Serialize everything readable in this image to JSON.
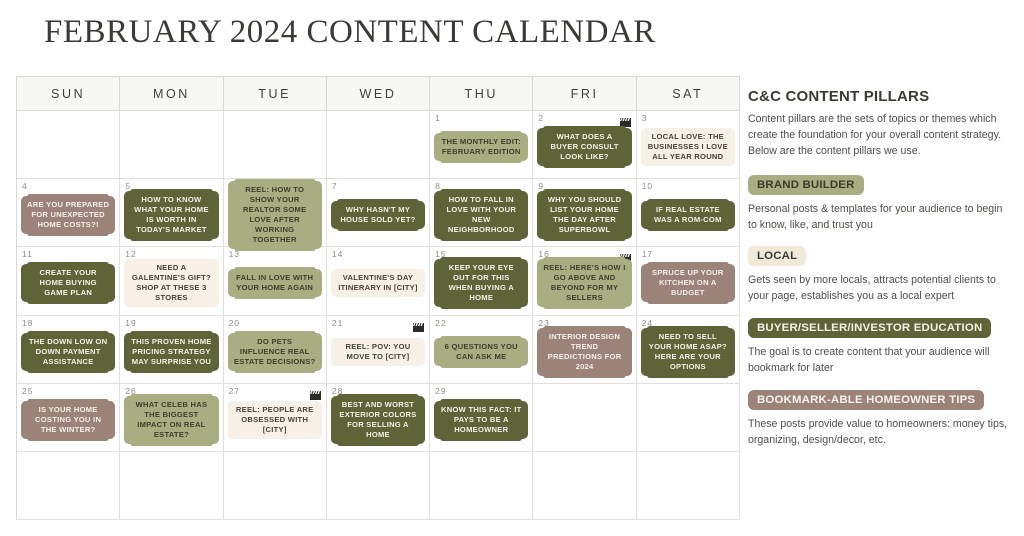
{
  "header": {
    "title": "FEBRUARY 2024 CONTENT CALENDAR"
  },
  "calendar": {
    "day_headers": [
      "SUN",
      "MON",
      "TUE",
      "WED",
      "THU",
      "FRI",
      "SAT"
    ],
    "weeks": [
      [
        {
          "day": "",
          "text": "",
          "style": "none",
          "reel": false
        },
        {
          "day": "",
          "text": "",
          "style": "none",
          "reel": false
        },
        {
          "day": "",
          "text": "",
          "style": "none",
          "reel": false
        },
        {
          "day": "",
          "text": "",
          "style": "none",
          "reel": false
        },
        {
          "day": "1",
          "text": "THE MONTHLY EDIT: FEBRUARY EDITION",
          "style": "light",
          "reel": false
        },
        {
          "day": "2",
          "text": "WHAT DOES A BUYER CONSULT LOOK LIKE?",
          "style": "dark",
          "reel": true
        },
        {
          "day": "3",
          "text": "LOCAL LOVE: THE BUSINESSES I LOVE ALL YEAR ROUND",
          "style": "cream",
          "reel": false
        }
      ],
      [
        {
          "day": "4",
          "text": "ARE YOU PREPARED FOR UNEXPECTED HOME COSTS?!",
          "style": "mauve",
          "reel": false
        },
        {
          "day": "5",
          "text": "HOW TO KNOW WHAT YOUR HOME IS WORTH IN TODAY'S MARKET",
          "style": "dark",
          "reel": false
        },
        {
          "day": "6",
          "text": "REEL: HOW TO SHOW YOUR REALTOR SOME LOVE AFTER WORKING TOGETHER",
          "style": "light",
          "reel": true
        },
        {
          "day": "7",
          "text": "WHY HASN'T MY HOUSE SOLD YET?",
          "style": "dark",
          "reel": false
        },
        {
          "day": "8",
          "text": "HOW TO FALL IN LOVE WITH YOUR NEW NEIGHBORHOOD",
          "style": "dark",
          "reel": false
        },
        {
          "day": "9",
          "text": "WHY YOU SHOULD LIST YOUR HOME THE DAY AFTER SUPERBOWL",
          "style": "dark",
          "reel": false
        },
        {
          "day": "10",
          "text": "IF REAL ESTATE WAS A ROM-COM",
          "style": "dark",
          "reel": false
        }
      ],
      [
        {
          "day": "11",
          "text": "CREATE YOUR HOME BUYING GAME PLAN",
          "style": "dark",
          "reel": false
        },
        {
          "day": "12",
          "text": "NEED A GALENTINE'S GIFT? SHOP AT THESE 3 STORES",
          "style": "cream",
          "reel": false
        },
        {
          "day": "13",
          "text": "FALL IN LOVE WITH YOUR HOME AGAIN",
          "style": "light",
          "reel": false
        },
        {
          "day": "14",
          "text": "VALENTINE'S DAY ITINERARY IN [CITY]",
          "style": "cream",
          "reel": false
        },
        {
          "day": "15",
          "text": "KEEP YOUR EYE OUT FOR THIS WHEN BUYING A HOME",
          "style": "dark",
          "reel": false
        },
        {
          "day": "16",
          "text": "REEL: HERE'S HOW I GO ABOVE AND BEYOND FOR MY SELLERS",
          "style": "light",
          "reel": true
        },
        {
          "day": "17",
          "text": "SPRUCE UP YOUR KITCHEN ON A BUDGET",
          "style": "mauve",
          "reel": false
        }
      ],
      [
        {
          "day": "18",
          "text": "THE DOWN LOW ON DOWN PAYMENT ASSISTANCE",
          "style": "dark",
          "reel": false
        },
        {
          "day": "19",
          "text": "THIS PROVEN HOME PRICING STRATEGY MAY SURPRISE YOU",
          "style": "dark",
          "reel": false
        },
        {
          "day": "20",
          "text": "DO PETS INFLUENCE REAL ESTATE DECISIONS?",
          "style": "light",
          "reel": false
        },
        {
          "day": "21",
          "text": "REEL: POV: YOU MOVE TO [CITY]",
          "style": "cream",
          "reel": true
        },
        {
          "day": "22",
          "text": "6 QUESTIONS YOU CAN ASK ME",
          "style": "light",
          "reel": false
        },
        {
          "day": "23",
          "text": "INTERIOR DESIGN TREND PREDICTIONS FOR 2024",
          "style": "mauve",
          "reel": false
        },
        {
          "day": "24",
          "text": "NEED TO SELL YOUR HOME ASAP? HERE ARE YOUR OPTIONS",
          "style": "dark",
          "reel": false
        }
      ],
      [
        {
          "day": "25",
          "text": "IS YOUR HOME COSTING YOU IN THE WINTER?",
          "style": "mauve",
          "reel": false
        },
        {
          "day": "26",
          "text": "WHAT CELEB HAS THE BIGGEST IMPACT ON REAL ESTATE?",
          "style": "light",
          "reel": false
        },
        {
          "day": "27",
          "text": "REEL: PEOPLE ARE OBSESSED WITH [CITY]",
          "style": "cream",
          "reel": true
        },
        {
          "day": "28",
          "text": "BEST AND WORST EXTERIOR COLORS FOR SELLING A HOME",
          "style": "dark",
          "reel": false
        },
        {
          "day": "29",
          "text": "KNOW THIS FACT: IT PAYS TO BE A HOMEOWNER",
          "style": "dark",
          "reel": false
        },
        {
          "day": "",
          "text": "",
          "style": "none",
          "reel": false
        },
        {
          "day": "",
          "text": "",
          "style": "none",
          "reel": false
        }
      ],
      [
        {
          "day": "",
          "text": "",
          "style": "none",
          "reel": false
        },
        {
          "day": "",
          "text": "",
          "style": "none",
          "reel": false
        },
        {
          "day": "",
          "text": "",
          "style": "none",
          "reel": false
        },
        {
          "day": "",
          "text": "",
          "style": "none",
          "reel": false
        },
        {
          "day": "",
          "text": "",
          "style": "none",
          "reel": false
        },
        {
          "day": "",
          "text": "",
          "style": "none",
          "reel": false
        },
        {
          "day": "",
          "text": "",
          "style": "none",
          "reel": false
        }
      ]
    ]
  },
  "sidebar": {
    "title": "C&C CONTENT PILLARS",
    "intro": "Content pillars are the sets of topics or themes which create the foundation for your overall content strategy. Below are the content pillars we use.",
    "pillars": [
      {
        "label": "BRAND BUILDER",
        "style": "light",
        "desc": "Personal posts & templates for your audience to begin to know, like, and trust you"
      },
      {
        "label": "LOCAL",
        "style": "cream",
        "desc": "Gets seen by more locals, attracts potential clients to your page, establishes you as a local expert"
      },
      {
        "label": "BUYER/SELLER/INVESTOR EDUCATION",
        "style": "dark",
        "desc": "The goal is to create content that your audience will bookmark for later"
      },
      {
        "label": "BOOKMARK-ABLE HOMEOWNER TIPS",
        "style": "mauve",
        "desc": "These posts provide value to homeowners: money tips, organizing, design/decor, etc."
      }
    ]
  },
  "colors": {
    "dark_olive": "#5e6438",
    "light_olive": "#a8ad82",
    "mauve": "#9c8379",
    "cream": "#f6f0e6",
    "text_dark": "#3a3a36"
  },
  "icons": {
    "reel": "clapperboard-icon"
  }
}
